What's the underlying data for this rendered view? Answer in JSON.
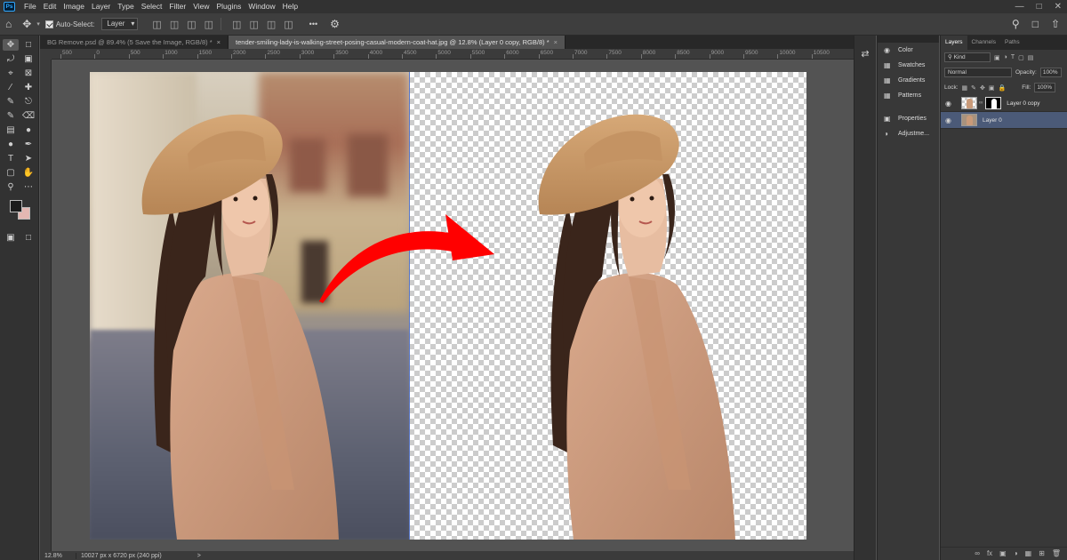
{
  "app": {
    "logo": "Ps"
  },
  "menu": [
    "File",
    "Edit",
    "Image",
    "Layer",
    "Type",
    "Select",
    "Filter",
    "View",
    "Plugins",
    "Window",
    "Help"
  ],
  "options": {
    "auto_select_label": "Auto-Select:",
    "auto_select_value": "Layer",
    "more_label": "•••"
  },
  "tabs": [
    {
      "title": "BG Remove.psd @ 89.4% (5 Save the Image, RGB/8) *",
      "close": "×"
    },
    {
      "title": "tender-smiling-lady-is-walking-street-posing-casual-modern-coat-hat.jpg @ 12.8% (Layer 0 copy, RGB/8) *",
      "close": "×"
    }
  ],
  "ruler": {
    "ticks": [
      "500",
      "0",
      "500",
      "1000",
      "1500",
      "2000",
      "2500",
      "3000",
      "3500",
      "4000",
      "4500",
      "5000",
      "5500",
      "6000",
      "6500",
      "7000",
      "7500",
      "8000",
      "8500",
      "9000",
      "9500",
      "10000",
      "10500"
    ]
  },
  "mini_panels": [
    {
      "icon": "color-icon",
      "label": "Color"
    },
    {
      "icon": "swatches-icon",
      "label": "Swatches"
    },
    {
      "icon": "gradients-icon",
      "label": "Gradients"
    },
    {
      "icon": "patterns-icon",
      "label": "Patterns"
    },
    {
      "icon": "properties-icon",
      "label": "Properties"
    },
    {
      "icon": "adjustments-icon",
      "label": "Adjustme..."
    }
  ],
  "layers_panel": {
    "tabs": [
      "Layers",
      "Channels",
      "Paths"
    ],
    "kind": "Kind",
    "blend_mode": "Normal",
    "opacity_label": "Opacity:",
    "opacity_value": "100%",
    "lock_label": "Lock:",
    "fill_label": "Fill:",
    "fill_value": "100%",
    "layers": [
      {
        "name": "Layer 0 copy",
        "selected": false,
        "has_mask": true
      },
      {
        "name": "Layer 0",
        "selected": true,
        "has_mask": false
      }
    ]
  },
  "status": {
    "zoom": "12.8%",
    "doc_size": "10027 px x 6720 px (240 ppi)",
    "arrow": ">"
  },
  "colors": {
    "accent_selection": "#4b5a78",
    "foreground": "#1c1c1c",
    "background": "#e3b7b2",
    "arrow": "#ff0000"
  }
}
